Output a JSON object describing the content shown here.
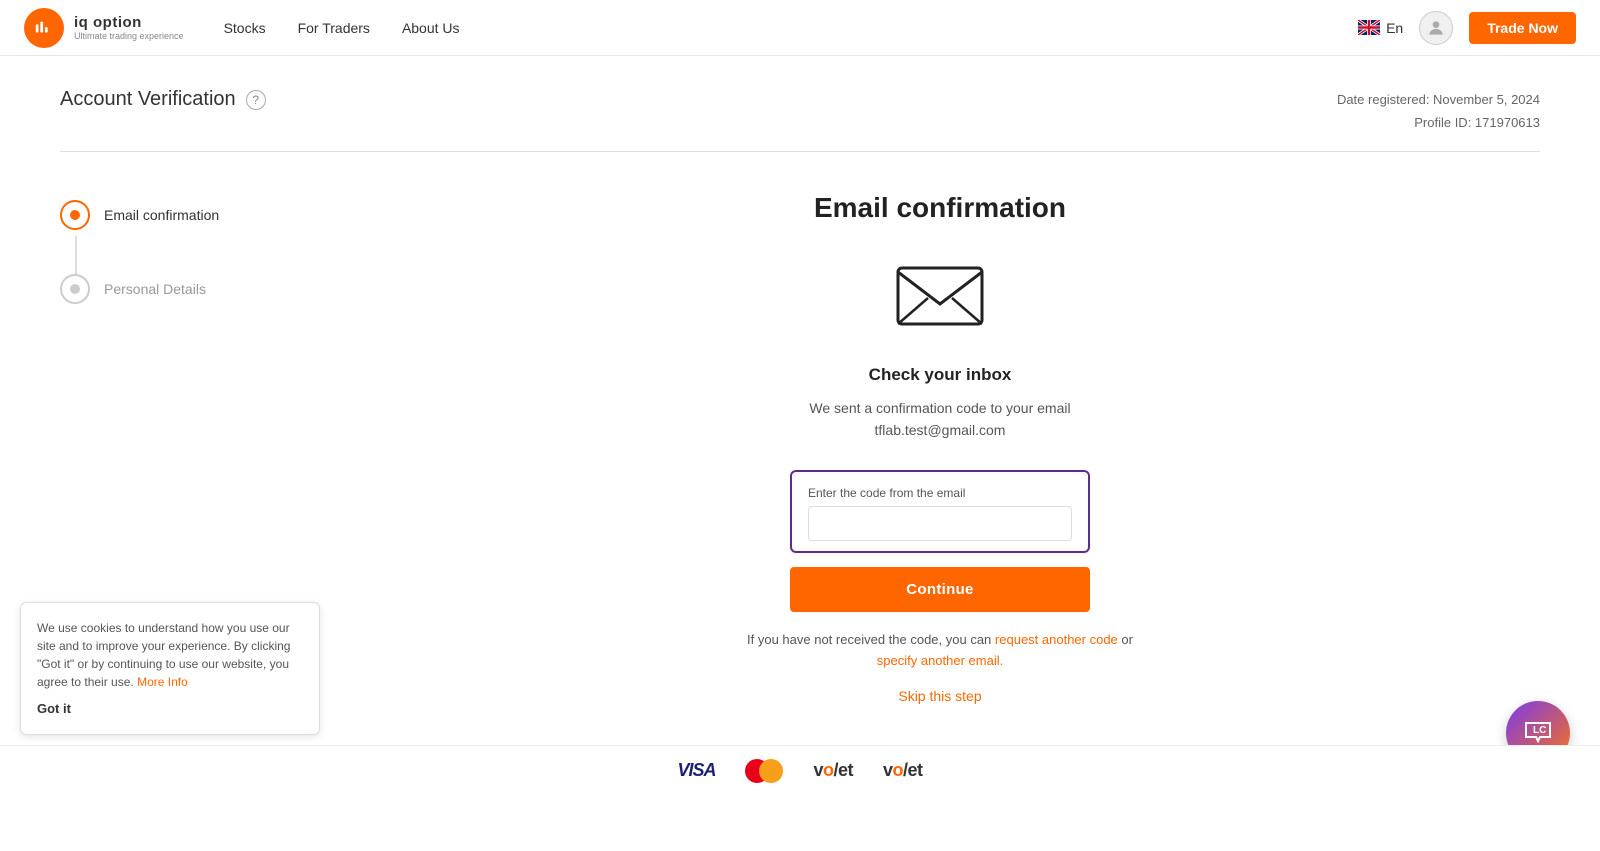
{
  "navbar": {
    "logo_brand": "iq option",
    "logo_sub": "Ultimate trading experience",
    "nav_links": [
      "Stocks",
      "For Traders",
      "About Us"
    ],
    "lang": "En",
    "trade_button": "Trade Now"
  },
  "page": {
    "title": "Account Verification",
    "help_icon": "?",
    "date_registered_label": "Date registered: November 5, 2024",
    "profile_id_label": "Profile ID: 171970613"
  },
  "steps": [
    {
      "label": "Email confirmation",
      "state": "active"
    },
    {
      "label": "Personal Details",
      "state": "inactive"
    }
  ],
  "email_confirmation": {
    "panel_title": "Email confirmation",
    "inbox_title": "Check your inbox",
    "inbox_desc_line1": "We sent a confirmation code to your email",
    "inbox_email": "tflab.test@gmail.com",
    "code_label": "Enter the code from the email",
    "code_placeholder": "",
    "continue_button": "Continue",
    "resend_text": "If you have not received the code, you can",
    "request_link": "request another code",
    "or_text": "or",
    "specify_link": "specify another email.",
    "skip_link": "Skip this step"
  },
  "cookie": {
    "text": "We use cookies to understand how you use our site and to improve your experience. By clicking \"Got it\" or by continuing to use our website, you agree to their use.",
    "more_link": "More Info",
    "got_it": "Got it"
  },
  "footer": {
    "logos": [
      "VISA",
      "Mastercard",
      "Volet1",
      "Volet2"
    ]
  }
}
